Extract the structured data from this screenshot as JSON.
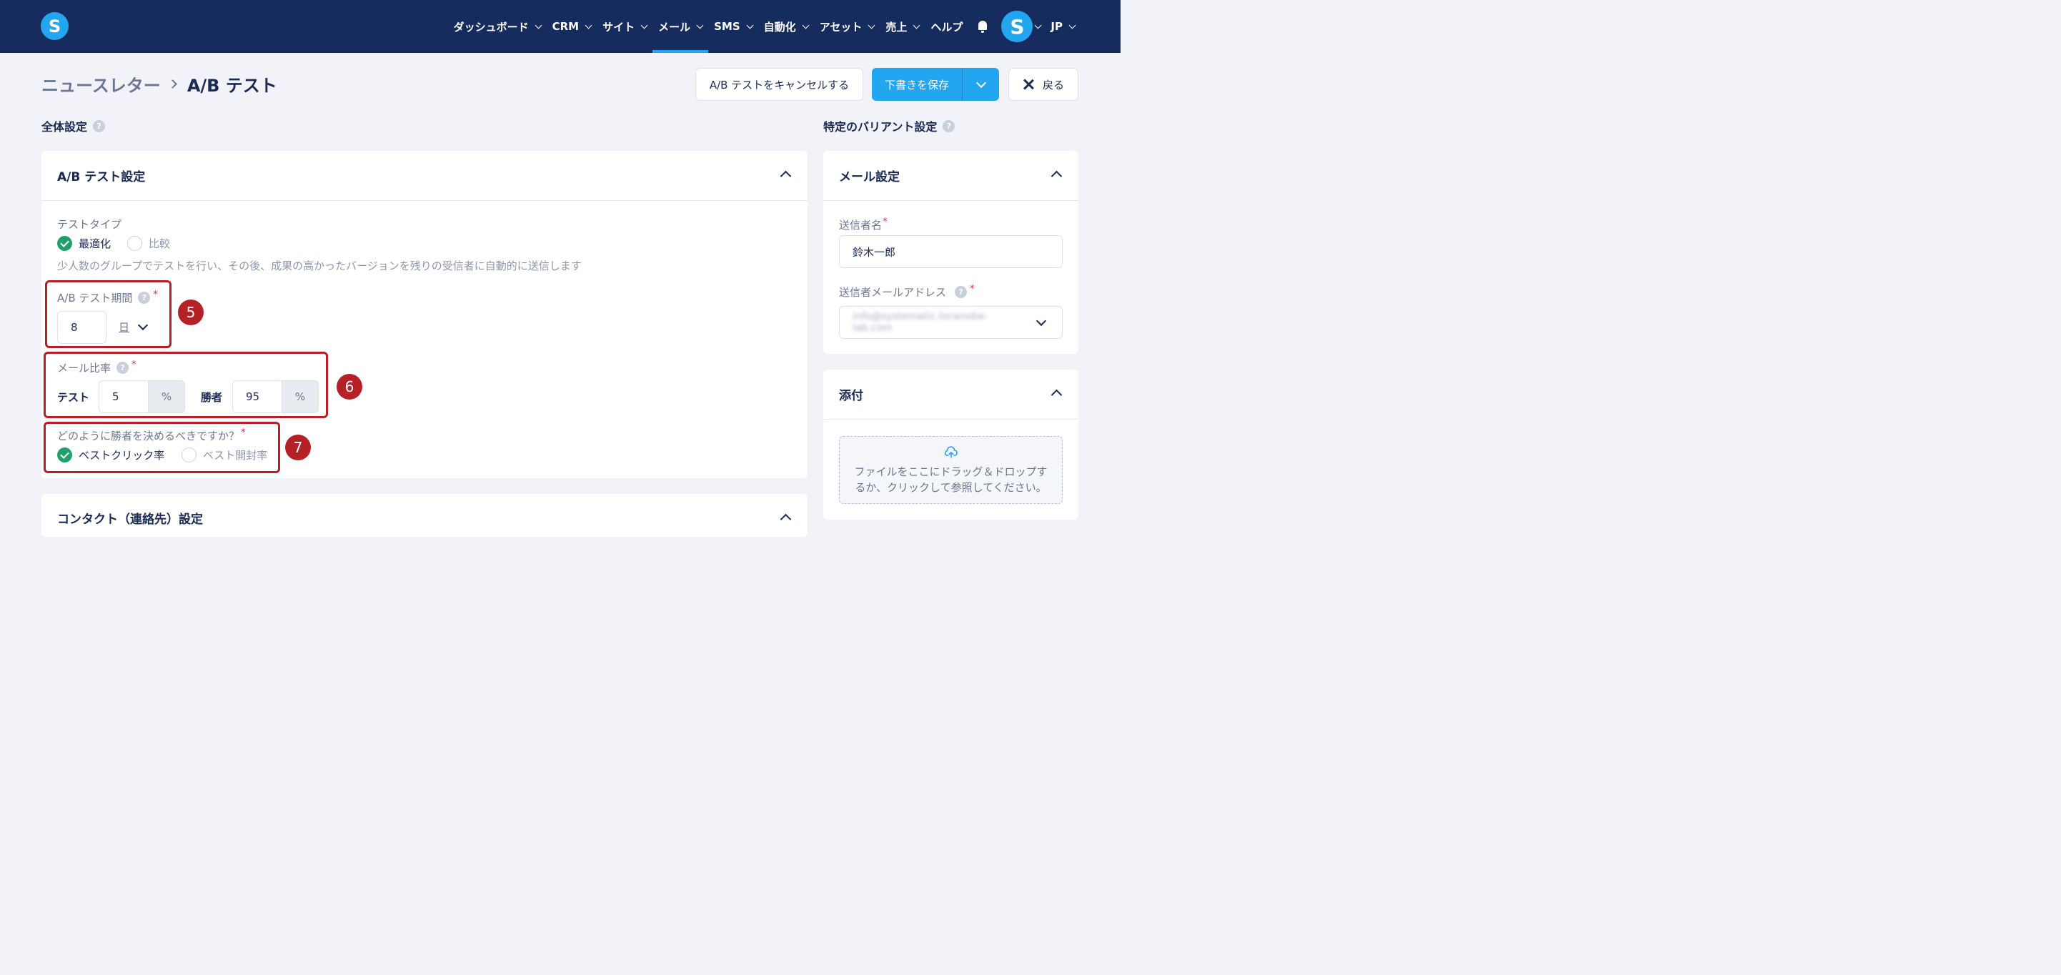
{
  "nav": {
    "logo": "S",
    "items": [
      {
        "label": "ダッシュボード",
        "has_menu": true,
        "active": false
      },
      {
        "label": "CRM",
        "has_menu": true,
        "active": false
      },
      {
        "label": "サイト",
        "has_menu": true,
        "active": false
      },
      {
        "label": "メール",
        "has_menu": true,
        "active": true
      },
      {
        "label": "SMS",
        "has_menu": true,
        "active": false
      },
      {
        "label": "自動化",
        "has_menu": true,
        "active": false
      },
      {
        "label": "アセット",
        "has_menu": true,
        "active": false
      },
      {
        "label": "売上",
        "has_menu": true,
        "active": false
      },
      {
        "label": "ヘルプ",
        "has_menu": false,
        "active": false
      }
    ],
    "avatar": "S",
    "language": "JP",
    "accent_color": "#23a6f0",
    "bar_color": "#172c5e"
  },
  "header": {
    "breadcrumb_parent": "ニュースレター",
    "breadcrumb_current": "A/B テスト",
    "cancel_label": "A/B テストをキャンセルする",
    "save_label": "下書きを保存",
    "back_label": "戻る"
  },
  "global_settings": {
    "title": "全体設定",
    "ab_card": {
      "title": "A/B テスト設定",
      "test_type_label": "テストタイプ",
      "test_type_options": [
        {
          "label": "最適化",
          "selected": true
        },
        {
          "label": "比較",
          "selected": false
        }
      ],
      "test_type_description": "少人数のグループでテストを行い、その後、成果の高かったバージョンを残りの受信者に自動的に送信します",
      "duration_label": "A/B テスト期間",
      "duration_value": "8",
      "duration_unit": "日",
      "ratio_label": "メール比率",
      "ratio_test_label": "テスト",
      "ratio_test_value": "5",
      "ratio_winner_label": "勝者",
      "ratio_winner_value": "95",
      "percent": "%",
      "winner_question": "どのように勝者を決めるべきですか？",
      "winner_options": [
        {
          "label": "ベストクリック率",
          "selected": true
        },
        {
          "label": "ベスト開封率",
          "selected": false
        }
      ]
    },
    "contact_card": {
      "title": "コンタクト（連絡先）設定"
    }
  },
  "variant_settings": {
    "title": "特定のバリアント設定",
    "mail_card": {
      "title": "メール設定",
      "sender_name_label": "送信者名",
      "sender_name_value": "鈴木一郎",
      "sender_email_label": "送信者メールアドレス",
      "sender_email_value": "info@systematic.toranobe-lab.com"
    },
    "attach_card": {
      "title": "添付",
      "dropzone_text": "ファイルをここにドラッグ＆ドロップするか、クリックして参照してください。"
    }
  },
  "annotations": [
    "5",
    "6",
    "7"
  ],
  "required_mark": "*",
  "help_mark": "?"
}
